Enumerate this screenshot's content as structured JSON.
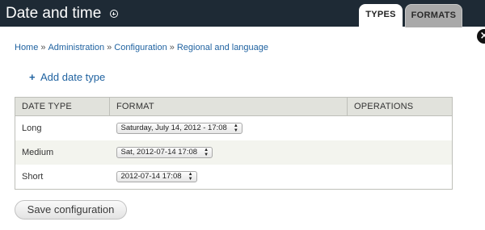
{
  "header": {
    "title": "Date and time",
    "tabs": [
      {
        "label": "TYPES",
        "active": true
      },
      {
        "label": "FORMATS",
        "active": false
      }
    ],
    "background_color": "#1e2a35"
  },
  "breadcrumb": [
    "Home",
    "Administration",
    "Configuration",
    "Regional and language"
  ],
  "breadcrumb_separator": "»",
  "actions": {
    "add_label": "Add date type",
    "add_icon": "+"
  },
  "table": {
    "columns": [
      "DATE TYPE",
      "FORMAT",
      "OPERATIONS"
    ],
    "rows": [
      {
        "type": "Long",
        "format": "Saturday, July 14, 2012 - 17:08",
        "operations": ""
      },
      {
        "type": "Medium",
        "format": "Sat, 2012-07-14 17:08",
        "operations": ""
      },
      {
        "type": "Short",
        "format": "2012-07-14 17:08",
        "operations": ""
      }
    ]
  },
  "save_label": "Save configuration",
  "close_icon": "×",
  "select_arrows_icon": "▲▼",
  "link_color": "#1f62a0"
}
